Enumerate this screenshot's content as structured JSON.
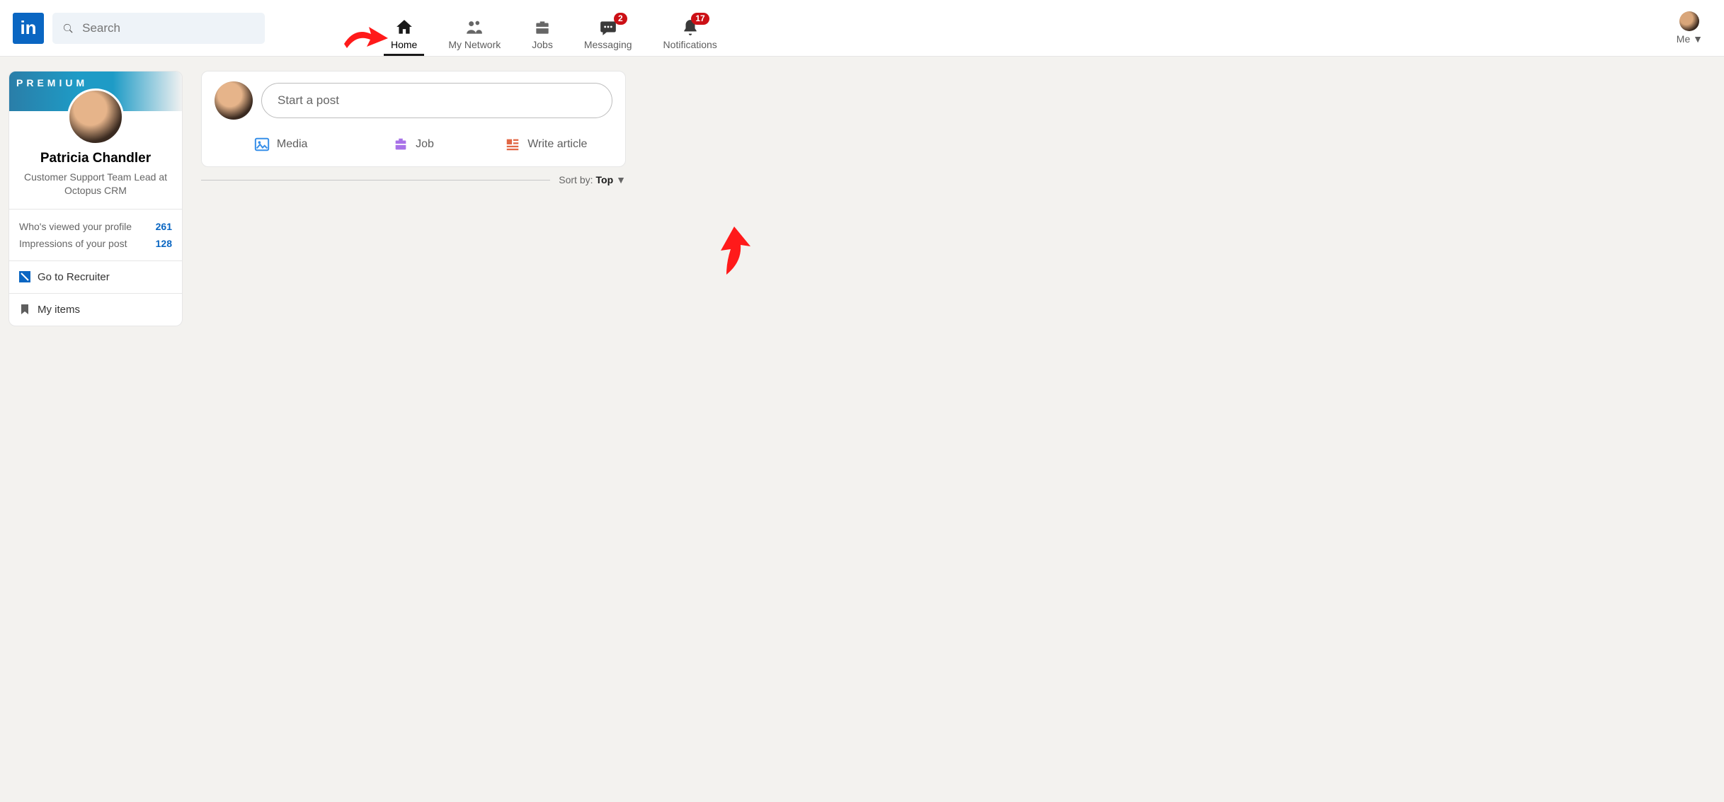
{
  "header": {
    "logo_text": "in",
    "search_placeholder": "Search",
    "nav": {
      "home": "Home",
      "network": "My Network",
      "jobs": "Jobs",
      "messaging": "Messaging",
      "notifications": "Notifications",
      "me": "Me"
    },
    "badges": {
      "messaging": "2",
      "notifications": "17"
    }
  },
  "profile": {
    "premium_label": "PREMIUM",
    "name": "Patricia Chandler",
    "headline": "Customer Support Team Lead at Octopus CRM",
    "stats": {
      "viewed_label": "Who's viewed your profile",
      "viewed_count": "261",
      "impressions_label": "Impressions of your post",
      "impressions_count": "128"
    },
    "recruiter_label": "Go to Recruiter",
    "my_items_label": "My items"
  },
  "post": {
    "start_placeholder": "Start a post",
    "media_label": "Media",
    "job_label": "Job",
    "article_label": "Write article"
  },
  "sort": {
    "prefix": "Sort by:",
    "value": "Top"
  }
}
